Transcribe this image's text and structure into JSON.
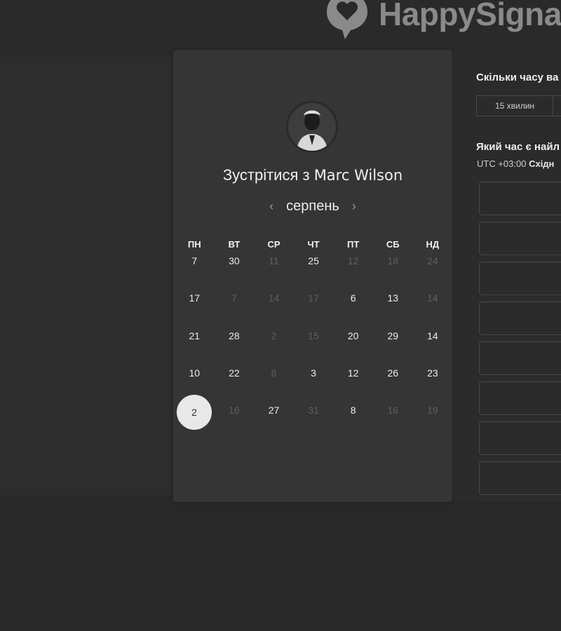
{
  "header": {
    "brand_name": "HappySigna",
    "logo_icon": "heart-speech-bubble-icon"
  },
  "card": {
    "title_prefix": "Зустрітися з",
    "host_name": "Marc Wilson",
    "avatar_icon": "person-avatar",
    "month": "серпень",
    "prev_icon": "chevron-left-icon",
    "next_icon": "chevron-right-icon",
    "weekdays": [
      "ПН",
      "ВТ",
      "СР",
      "ЧТ",
      "ПТ",
      "СБ",
      "НД"
    ],
    "weeks": [
      [
        {
          "d": "7",
          "on": true
        },
        {
          "d": "30",
          "on": true
        },
        {
          "d": "11",
          "on": false
        },
        {
          "d": "25",
          "on": true
        },
        {
          "d": "12",
          "on": false
        },
        {
          "d": "18",
          "on": false
        },
        {
          "d": "24",
          "on": false
        }
      ],
      [
        {
          "d": "17",
          "on": true
        },
        {
          "d": "7",
          "on": false
        },
        {
          "d": "14",
          "on": false
        },
        {
          "d": "17",
          "on": false
        },
        {
          "d": "6",
          "on": true
        },
        {
          "d": "13",
          "on": true
        },
        {
          "d": "14",
          "on": false
        }
      ],
      [
        {
          "d": "21",
          "on": true
        },
        {
          "d": "28",
          "on": true
        },
        {
          "d": "2",
          "on": false
        },
        {
          "d": "15",
          "on": false
        },
        {
          "d": "20",
          "on": true
        },
        {
          "d": "29",
          "on": true
        },
        {
          "d": "14",
          "on": true
        }
      ],
      [
        {
          "d": "10",
          "on": true
        },
        {
          "d": "22",
          "on": true
        },
        {
          "d": "8",
          "on": false
        },
        {
          "d": "3",
          "on": true
        },
        {
          "d": "12",
          "on": true
        },
        {
          "d": "26",
          "on": true
        },
        {
          "d": "23",
          "on": true
        }
      ],
      [
        {
          "d": "2",
          "on": true,
          "selected": true
        },
        {
          "d": "16",
          "on": false
        },
        {
          "d": "27",
          "on": true
        },
        {
          "d": "31",
          "on": false
        },
        {
          "d": "8",
          "on": true
        },
        {
          "d": "16",
          "on": false
        },
        {
          "d": "19",
          "on": false
        }
      ]
    ]
  },
  "right": {
    "duration_question": "Скільки часу ва",
    "duration_options": [
      "15 хвилин",
      ""
    ],
    "time_question": "Який час є найл",
    "timezone_prefix": "UTC +03:00",
    "timezone_name": "Східн",
    "slot_count_visible": 8
  },
  "colors": {
    "background": "#282828",
    "card": "#353535",
    "selected_day": "#e8e8e8"
  }
}
